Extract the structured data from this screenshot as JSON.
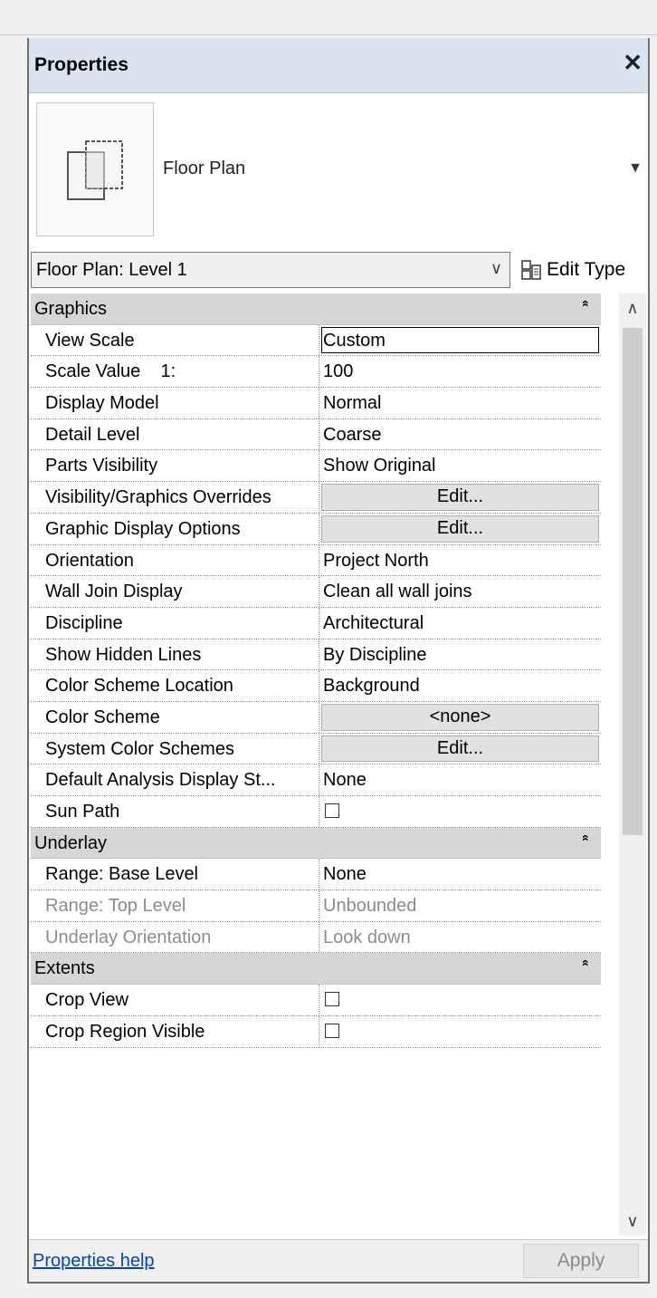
{
  "window": {
    "title": "Properties",
    "close_glyph": "✕"
  },
  "type_selector": {
    "icon": "floor-plan-view-icon",
    "name": "Floor Plan",
    "arrow": "▼"
  },
  "instance_selector": {
    "value": "Floor Plan: Level 1",
    "chevron": "∨"
  },
  "edit_type": {
    "label": "Edit Type",
    "icon": "edit-type-icon"
  },
  "sections": {
    "graphics": {
      "label": "Graphics"
    },
    "underlay": {
      "label": "Underlay"
    },
    "extents": {
      "label": "Extents"
    }
  },
  "collapse_glyph": "«",
  "rows": {
    "view_scale": {
      "name": "View Scale",
      "value": "Custom"
    },
    "scale_value": {
      "name": "Scale Value    1:",
      "value": "100"
    },
    "display_model": {
      "name": "Display Model",
      "value": "Normal"
    },
    "detail_level": {
      "name": "Detail Level",
      "value": "Coarse"
    },
    "parts_visibility": {
      "name": "Parts Visibility",
      "value": "Show Original"
    },
    "vg_overrides": {
      "name": "Visibility/Graphics Overrides",
      "value": "Edit..."
    },
    "graphic_display": {
      "name": "Graphic Display Options",
      "value": "Edit..."
    },
    "orientation": {
      "name": "Orientation",
      "value": "Project North"
    },
    "wall_join": {
      "name": "Wall Join Display",
      "value": "Clean all wall joins"
    },
    "discipline": {
      "name": "Discipline",
      "value": "Architectural"
    },
    "hidden_lines": {
      "name": "Show Hidden Lines",
      "value": "By Discipline"
    },
    "color_scheme_location": {
      "name": "Color Scheme Location",
      "value": "Background"
    },
    "color_scheme": {
      "name": "Color Scheme",
      "value": "<none>"
    },
    "system_color_schemes": {
      "name": "System Color Schemes",
      "value": "Edit..."
    },
    "default_analysis": {
      "name": "Default Analysis Display St...",
      "value": "None"
    },
    "sun_path": {
      "name": "Sun Path",
      "checked": false
    },
    "base_level": {
      "name": "Range: Base Level",
      "value": "None"
    },
    "top_level": {
      "name": "Range: Top Level",
      "value": "Unbounded"
    },
    "underlay_orientation": {
      "name": "Underlay Orientation",
      "value": "Look down"
    },
    "crop_view": {
      "name": "Crop View",
      "checked": false
    },
    "crop_region_visible": {
      "name": "Crop Region Visible",
      "checked": false
    }
  },
  "scrollbar": {
    "up": "∧",
    "down": "∨"
  },
  "footer": {
    "help_link": "Properties help",
    "apply_label": "Apply"
  },
  "colors": {
    "title_bar": "#d9e4ee",
    "section_bg": "#d6d6d6",
    "link": "#0645ad",
    "disabled_text": "#8c8c8c"
  }
}
